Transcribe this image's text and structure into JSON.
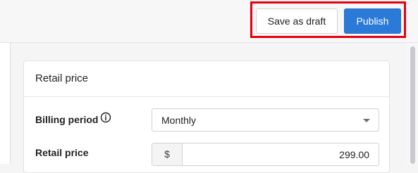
{
  "toolbar": {
    "draft_label": "Save as draft",
    "publish_label": "Publish"
  },
  "card": {
    "title": "Retail price",
    "billing_period": {
      "label": "Billing period",
      "icon": "info-icon",
      "selected": "Monthly"
    },
    "retail_price": {
      "label": "Retail price",
      "currency": "$",
      "value": "299.00"
    }
  },
  "colors": {
    "primary": "#2b7ad8",
    "highlight": "#e3000f"
  }
}
